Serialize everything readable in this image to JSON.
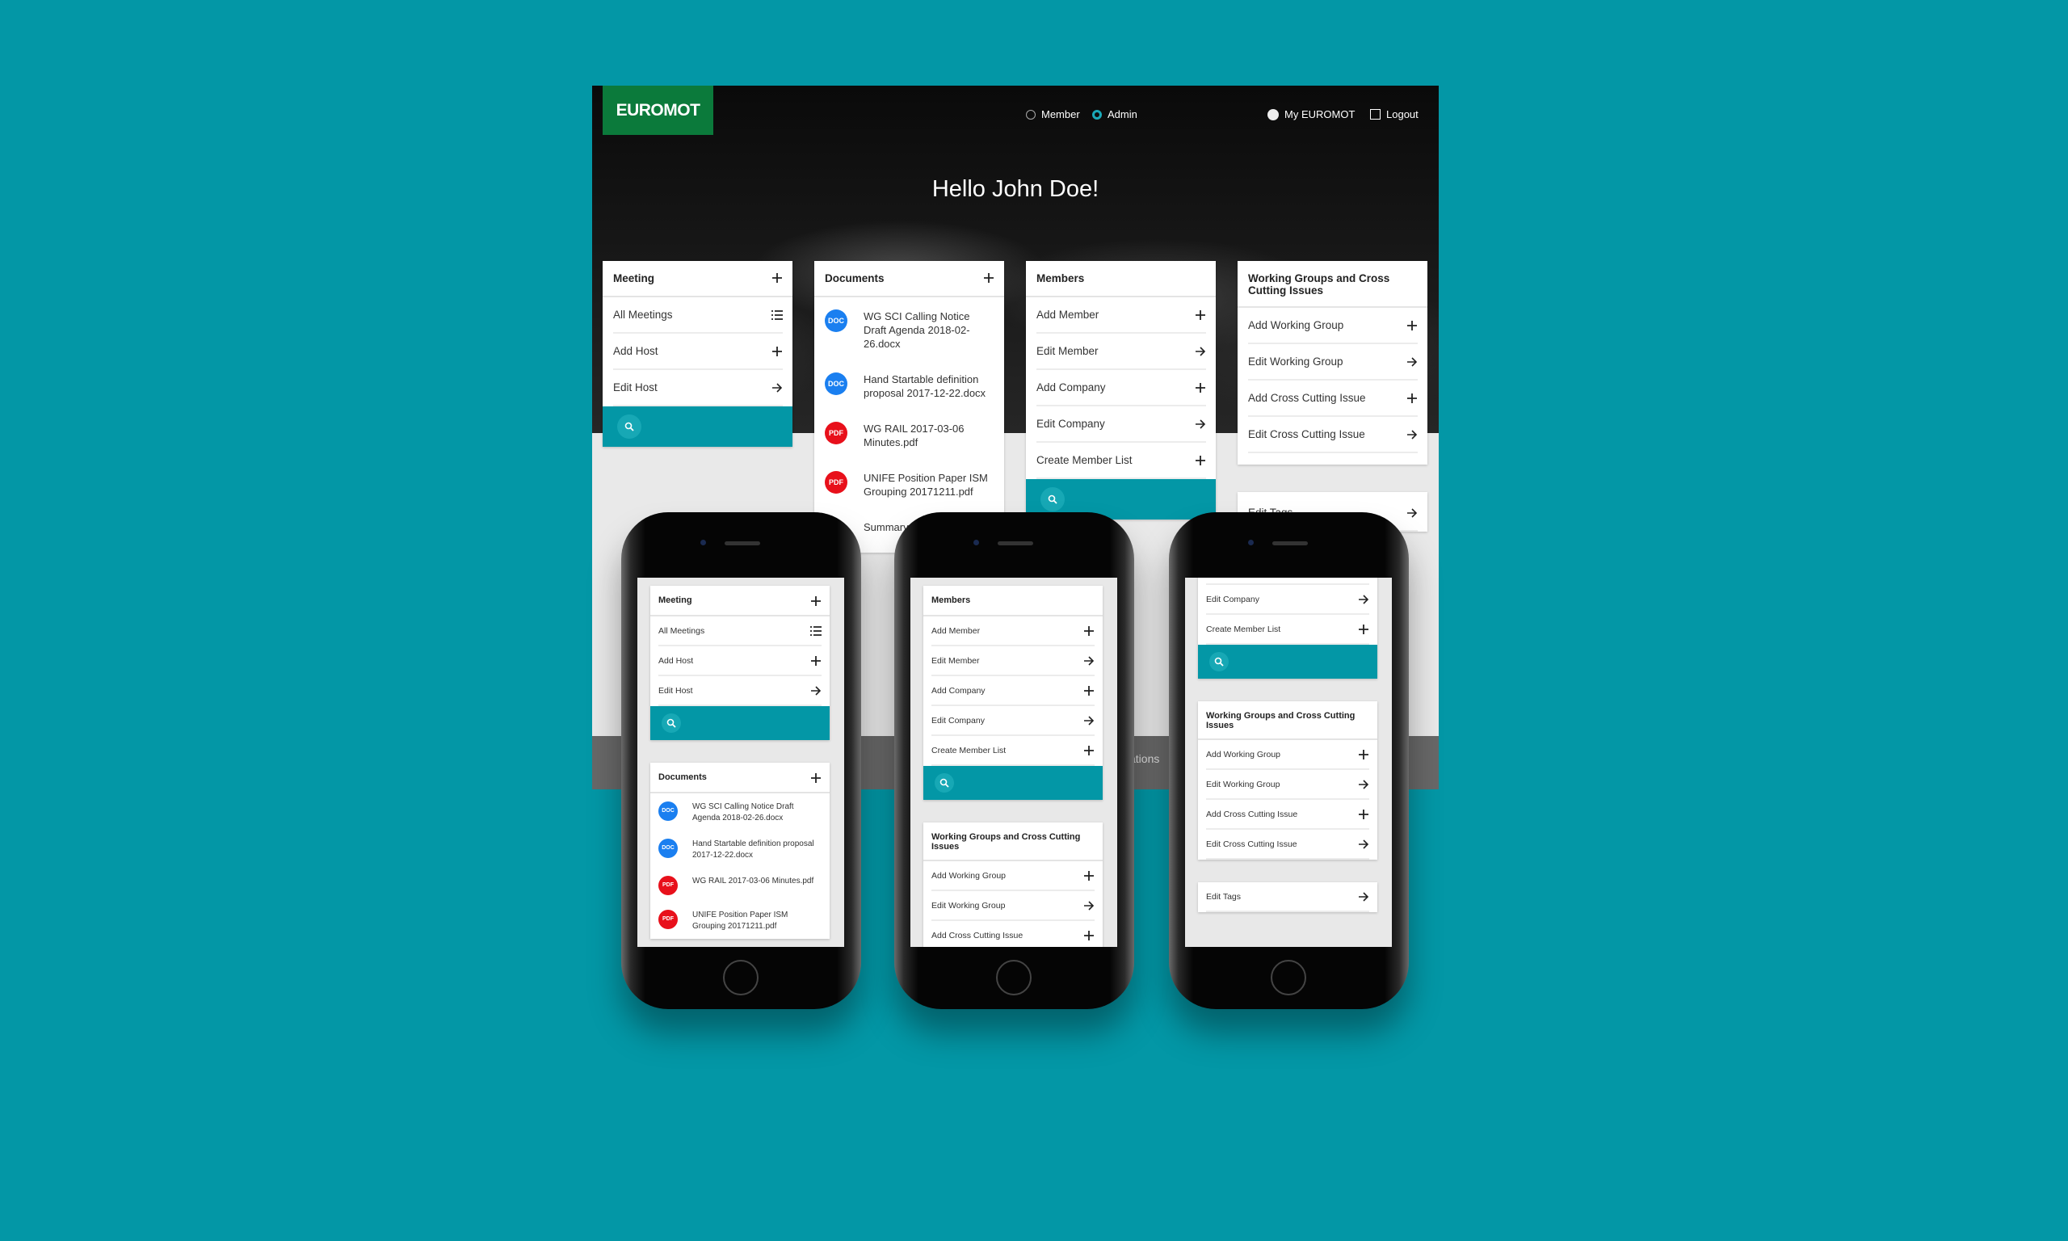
{
  "header": {
    "logo": "EUROMOT",
    "role_member": "Member",
    "role_admin": "Admin",
    "selected_role": "Admin",
    "my_account": "My EUROMOT",
    "logout": "Logout"
  },
  "hero": {
    "greeting": "Hello John Doe!"
  },
  "footer_fragment": "ations",
  "colors": {
    "background": "#0397a6",
    "accent": "#0397a6",
    "logo": "#0b7a3b",
    "doc_badge": "#1a7ff0",
    "pdf_badge": "#e8101b"
  },
  "cards": {
    "meeting": {
      "title": "Meeting",
      "items": [
        {
          "label": "All Meetings",
          "icon": "list"
        },
        {
          "label": "Add Host",
          "icon": "plus"
        },
        {
          "label": "Edit Host",
          "icon": "arrow-right"
        }
      ],
      "search": true
    },
    "documents": {
      "title": "Documents",
      "docs": [
        {
          "type": "DOC",
          "name": "WG SCI Calling Notice Draft Agenda 2018-02-26.docx"
        },
        {
          "type": "DOC",
          "name": "Hand Startable definition proposal 2017-12-22.docx"
        },
        {
          "type": "PDF",
          "name": "WG RAIL 2017-03-06 Minutes.pdf"
        },
        {
          "type": "PDF",
          "name": "UNIFE Position Paper ISM Grouping 20171211.pdf"
        },
        {
          "type": "",
          "name": "Summary 201709"
        }
      ]
    },
    "members": {
      "title": "Members",
      "items": [
        {
          "label": "Add Member",
          "icon": "plus"
        },
        {
          "label": "Edit Member",
          "icon": "arrow-right"
        },
        {
          "label": "Add Company",
          "icon": "plus"
        },
        {
          "label": "Edit Company",
          "icon": "arrow-right"
        },
        {
          "label": "Create Member List",
          "icon": "plus"
        }
      ],
      "search": true
    },
    "working_groups": {
      "title": "Working Groups and Cross Cutting Issues",
      "items": [
        {
          "label": "Add Working Group",
          "icon": "plus"
        },
        {
          "label": "Edit Working Group",
          "icon": "arrow-right"
        },
        {
          "label": "Add Cross Cutting Issue",
          "icon": "plus"
        },
        {
          "label": "Edit Cross Cutting Issue",
          "icon": "arrow-right"
        }
      ]
    },
    "tags": {
      "items": [
        {
          "label": "Edit Tags",
          "icon": "arrow-right"
        }
      ]
    }
  }
}
